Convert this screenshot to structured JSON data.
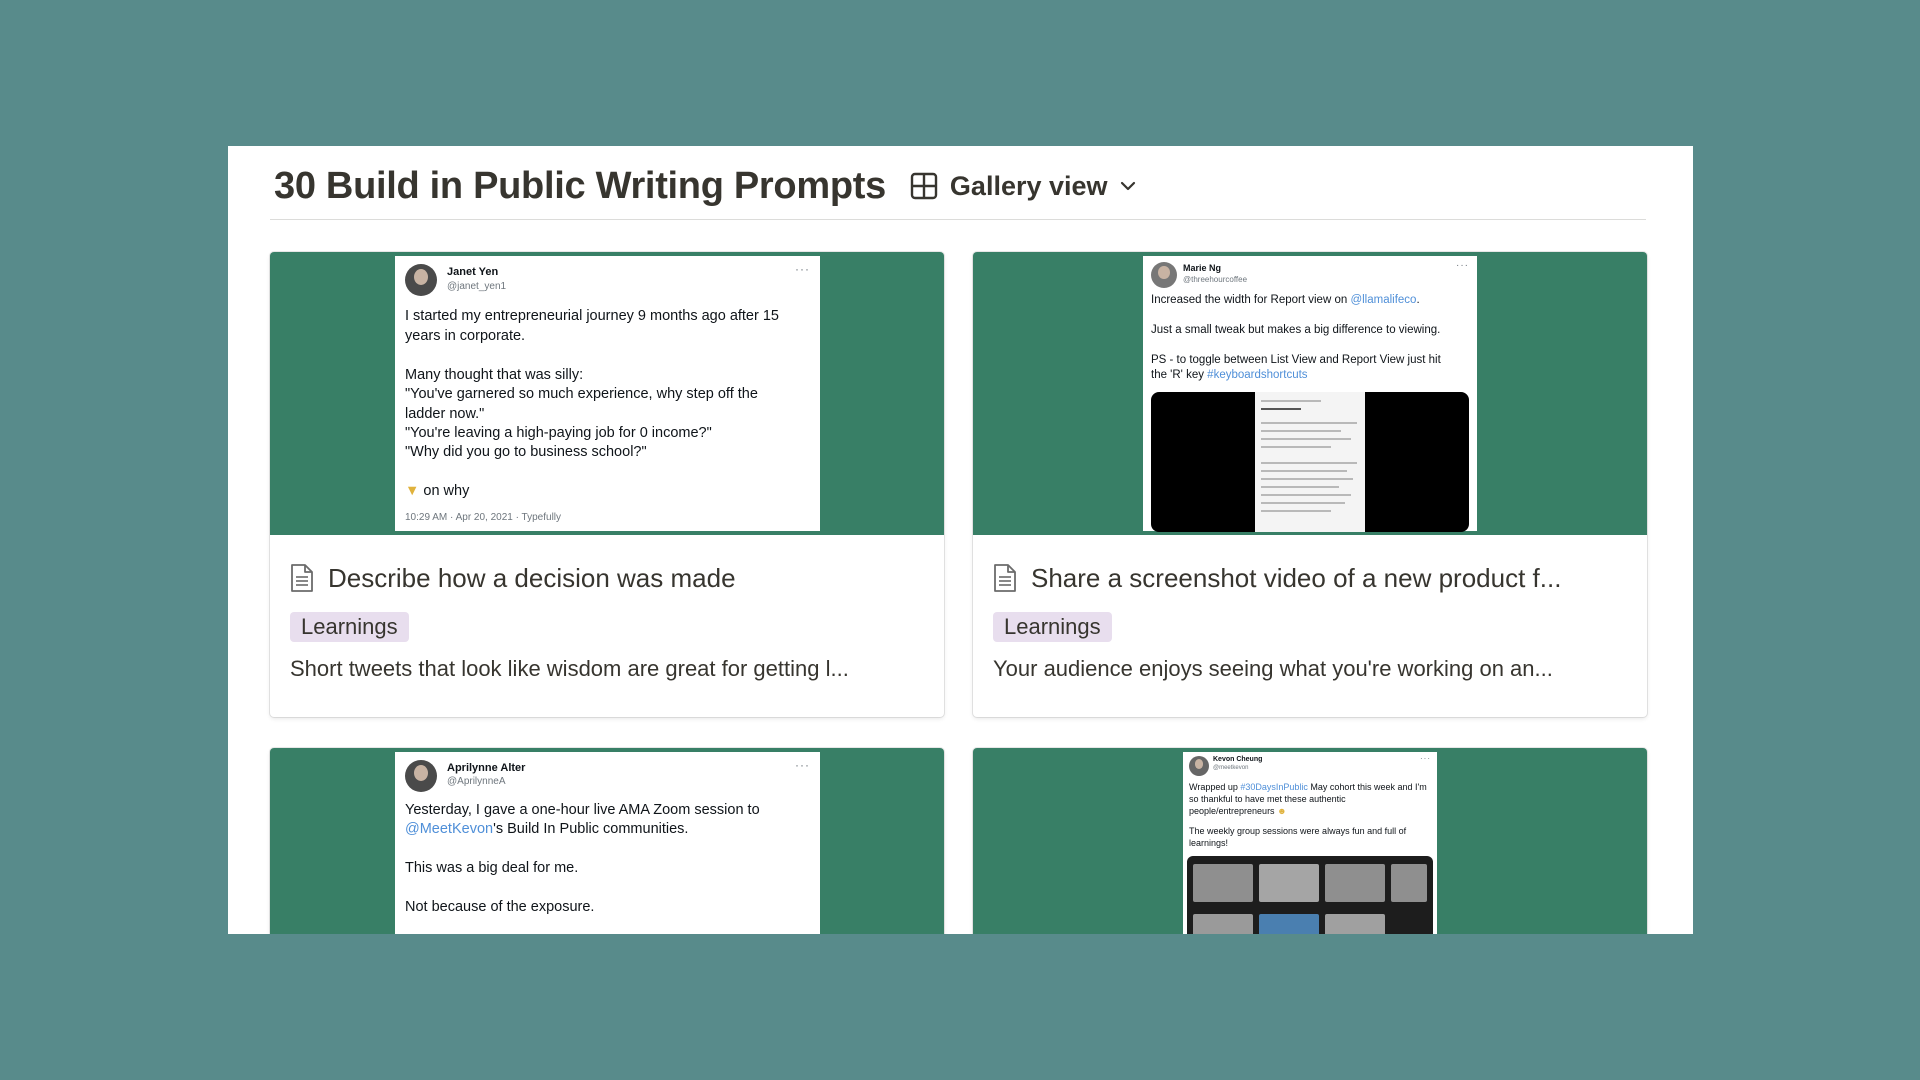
{
  "header": {
    "title": "30 Build in Public Writing Prompts",
    "view_label": "Gallery view"
  },
  "icons": {
    "view": "gallery-grid-icon",
    "chevron": "chevron-down-icon",
    "page": "document-icon"
  },
  "colors": {
    "background": "#588b8b",
    "cover": "#387f66",
    "tag": "#e8deee",
    "link": "#4f8fd8"
  },
  "cards": [
    {
      "title": "Describe how a decision was made",
      "tag": "Learnings",
      "description": "Short tweets that look like wisdom are great for getting l...",
      "tweet": {
        "name": "Janet Yen",
        "handle": "@janet_yen1",
        "lines": [
          "I started my entrepreneurial journey 9 months ago after 15",
          "years in corporate.",
          "Many thought that was silly:",
          "\"You've garnered so much experience, why step off the",
          "ladder now.\"",
          "\"You're leaving a high-paying job for 0 income?\"",
          "\"Why did you go to business school?\"",
          "on why"
        ],
        "meta": "10:29 AM · Apr 20, 2021 · Typefully"
      }
    },
    {
      "title": "Share a screenshot video of a new product f...",
      "tag": "Learnings",
      "description": "Your audience enjoys seeing what you're working on an...",
      "tweet": {
        "name": "Marie Ng",
        "handle": "@threehourcoffee",
        "line1_prefix": "Increased the width for Report view on ",
        "line1_link": "@llamalifeco",
        "line1_suffix": ".",
        "line2": "Just a small tweak but makes a big difference to viewing.",
        "line3": "PS - to toggle between List View and Report View just hit",
        "line4_prefix": "the 'R' key ",
        "line4_link": "#keyboardshortcuts"
      }
    },
    {
      "tweet": {
        "name": "Aprilynne Alter",
        "handle": "@AprilynneA",
        "line1": "Yesterday, I gave a one-hour live AMA Zoom session to",
        "line2_link": "@MeetKevon",
        "line2_suffix": "'s Build In Public communities.",
        "line3": "This was a big deal for me.",
        "line4": "Not because of the exposure."
      }
    },
    {
      "tweet": {
        "name": "Kevon Cheung",
        "handle": "@meetkevon",
        "line1_prefix": "Wrapped up ",
        "line1_link": "#30DaysInPublic",
        "line1_suffix": " May cohort this week and I'm",
        "line2": "so thankful to have met these authentic",
        "line3": "people/entrepreneurs",
        "line4": "The weekly group sessions were always fun and full of",
        "line5": "learnings!"
      }
    }
  ]
}
